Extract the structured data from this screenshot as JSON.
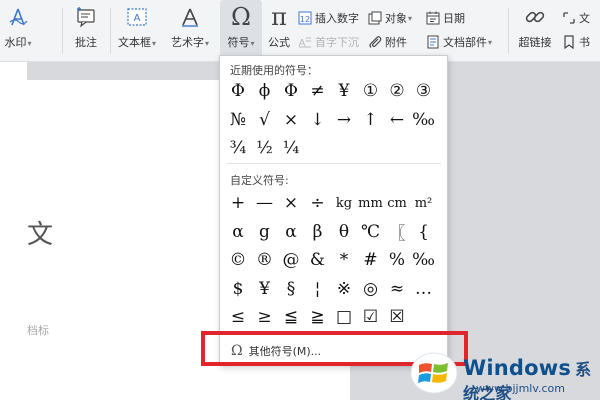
{
  "ribbon": {
    "partial_left_label": "水印",
    "annotate_label": "批注",
    "textbox_label": "文本框",
    "wordart_label": "艺术字",
    "symbol_label": "符号",
    "formula_label": "公式",
    "insert_number_label": "插入数字",
    "object_label": "对象",
    "date_label": "日期",
    "sink_drop_label": "首字下沉",
    "attachment_label": "附件",
    "doc_parts_label": "文档部件",
    "hyperlink_label": "超链接",
    "caret": "▾"
  },
  "document": {
    "partial_glyph": "文",
    "partial_faint_text": "档标"
  },
  "symbol_menu": {
    "recent_title": "近期使用的符号：",
    "recent_symbols": [
      "Φ",
      "ϕ",
      "Φ",
      "≠",
      "¥",
      "①",
      "②",
      "③",
      "№",
      "√",
      "×",
      "↓",
      "→",
      "↑",
      "←",
      "‰",
      "¾",
      "½",
      "¼"
    ],
    "custom_title": "自定义符号:",
    "custom_symbols": [
      "+",
      "—",
      "×",
      "÷",
      "kg",
      "mm",
      "cm",
      "m²",
      "α",
      "g",
      "α",
      "β",
      "θ",
      "℃",
      "〖",
      "{",
      "©",
      "®",
      "@",
      "&",
      "*",
      "#",
      "%",
      "‰",
      "$",
      "¥",
      "§",
      "¦",
      "※",
      "◎",
      "≈",
      "…",
      "≤",
      "≥",
      "≦",
      "≧",
      "□",
      "☑",
      "☒"
    ],
    "more_symbols_label": "其他符号(M)...",
    "more_symbols_icon": "Ω"
  },
  "watermark": {
    "title": "Windows",
    "subtitle": "系统之家",
    "url": "www.bjjmlv.com"
  },
  "colors": {
    "highlight_red": "#e0252d",
    "ribbon_bg": "#f3f4f6",
    "watermark_blue": "#0f4f8c"
  }
}
